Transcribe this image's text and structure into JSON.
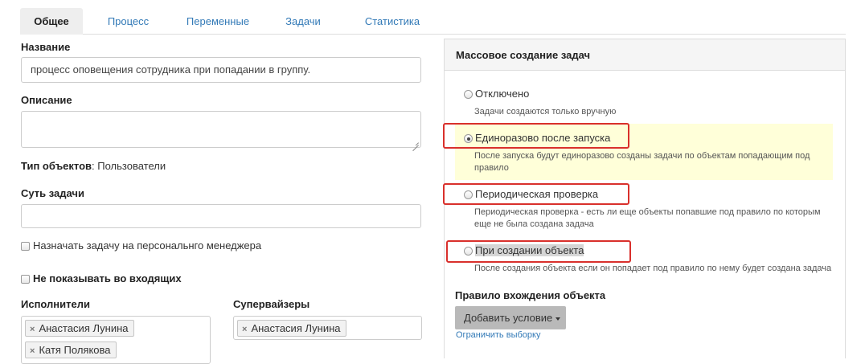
{
  "tabs": [
    "Общее",
    "Процесс",
    "Переменные",
    "Задачи",
    "Статистика"
  ],
  "form": {
    "name_label": "Название",
    "name_value": "процесс оповещения сотрудника при попадании в группу.",
    "description_label": "Описание",
    "object_type_label": "Тип объектов",
    "object_type_value": ": Пользователи",
    "task_essence_label": "Суть задачи",
    "assign_manager_label": "Назначать задачу на персональнго менеджера",
    "hide_inbox_label": "Не показывать во входящих",
    "executors_label": "Исполнители",
    "executors": [
      "Анастасия Лунина",
      "Катя Полякова"
    ],
    "supervisors_label": "Супервайзеры",
    "supervisors": [
      "Анастасия Лунина"
    ],
    "tag_remove_glyph": "×"
  },
  "mass_panel": {
    "title": "Массовое создание задач",
    "options": [
      {
        "label": "Отключено",
        "hint": "Задачи создаются только вручную",
        "selected": false
      },
      {
        "label": "Единоразово после запуска",
        "hint": "После запуска будут единоразово созданы задачи по объектам попадающим под правило",
        "selected": true
      },
      {
        "label": "Периодическая проверка",
        "hint": "Периодическая проверка - есть ли еще объекты попавшие под правило по которым еще не была создана задача",
        "selected": false
      },
      {
        "label": "При создании объекта",
        "hint": "После создания объекта если он попадает под правило по нему будет создана задача",
        "selected": false
      }
    ],
    "rule_label": "Правило вхождения объекта",
    "add_condition_button": "Добавить условие",
    "limit_link": "Ограничить выборку"
  },
  "colors": {
    "accent": "#337ab7",
    "highlight_border": "#d9302c",
    "highlight_bg": "#ffffd9"
  }
}
